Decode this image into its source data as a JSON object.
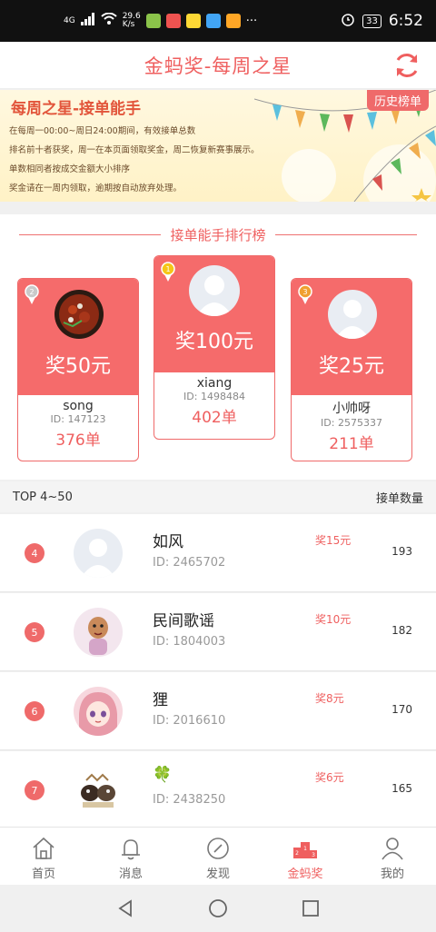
{
  "status_bar": {
    "network": "4G",
    "speed_value": "29.6",
    "speed_unit": "K/s",
    "battery": "33",
    "time": "6:52"
  },
  "header": {
    "title": "金蚂奖-每周之星",
    "refresh_icon": "refresh-icon"
  },
  "banner": {
    "title": "每周之星-接单能手",
    "history_label": "历史榜单",
    "lines": [
      "在每周一00:00~周日24:00期间，有效接单总数",
      "排名前十者获奖，周一在本页面领取奖金，周二恢复新赛事展示。",
      "单数相同者按成交金额大小排序",
      "奖金请在一周内领取，逾期按自动放弃处理。"
    ]
  },
  "leaderboard": {
    "heading": "接单能手排行榜",
    "top3": [
      {
        "rank": "2",
        "prize": "奖50元",
        "name": "song",
        "id": "ID: 147123",
        "count": "376单"
      },
      {
        "rank": "1",
        "prize": "奖100元",
        "name": "xiang",
        "id": "ID: 1498484",
        "count": "402单"
      },
      {
        "rank": "3",
        "prize": "奖25元",
        "name": "小帅呀",
        "id": "ID: 2575337",
        "count": "211单"
      }
    ]
  },
  "list": {
    "left_header": "TOP 4~50",
    "right_header": "接单数量",
    "rows": [
      {
        "rank": "4",
        "name": "如风",
        "id": "ID: 2465702",
        "prize": "奖15元",
        "count": "193"
      },
      {
        "rank": "5",
        "name": "民间歌谣",
        "id": "ID: 1804003",
        "prize": "奖10元",
        "count": "182"
      },
      {
        "rank": "6",
        "name": "狸",
        "id": "ID: 2016610",
        "prize": "奖8元",
        "count": "170"
      },
      {
        "rank": "7",
        "name": "🍀",
        "id": "ID: 2438250",
        "prize": "奖6元",
        "count": "165"
      }
    ]
  },
  "tabbar": {
    "tabs": [
      {
        "label": "首页",
        "icon": "home-icon"
      },
      {
        "label": "消息",
        "icon": "bell-icon"
      },
      {
        "label": "发现",
        "icon": "compass-icon"
      },
      {
        "label": "金蚂奖",
        "icon": "podium-icon"
      },
      {
        "label": "我的",
        "icon": "user-icon"
      }
    ],
    "active": "金蚂奖"
  },
  "colors": {
    "accent": "#ef5f5f",
    "card_top": "#f56b6b",
    "banner_bg": "#fff4cf"
  }
}
